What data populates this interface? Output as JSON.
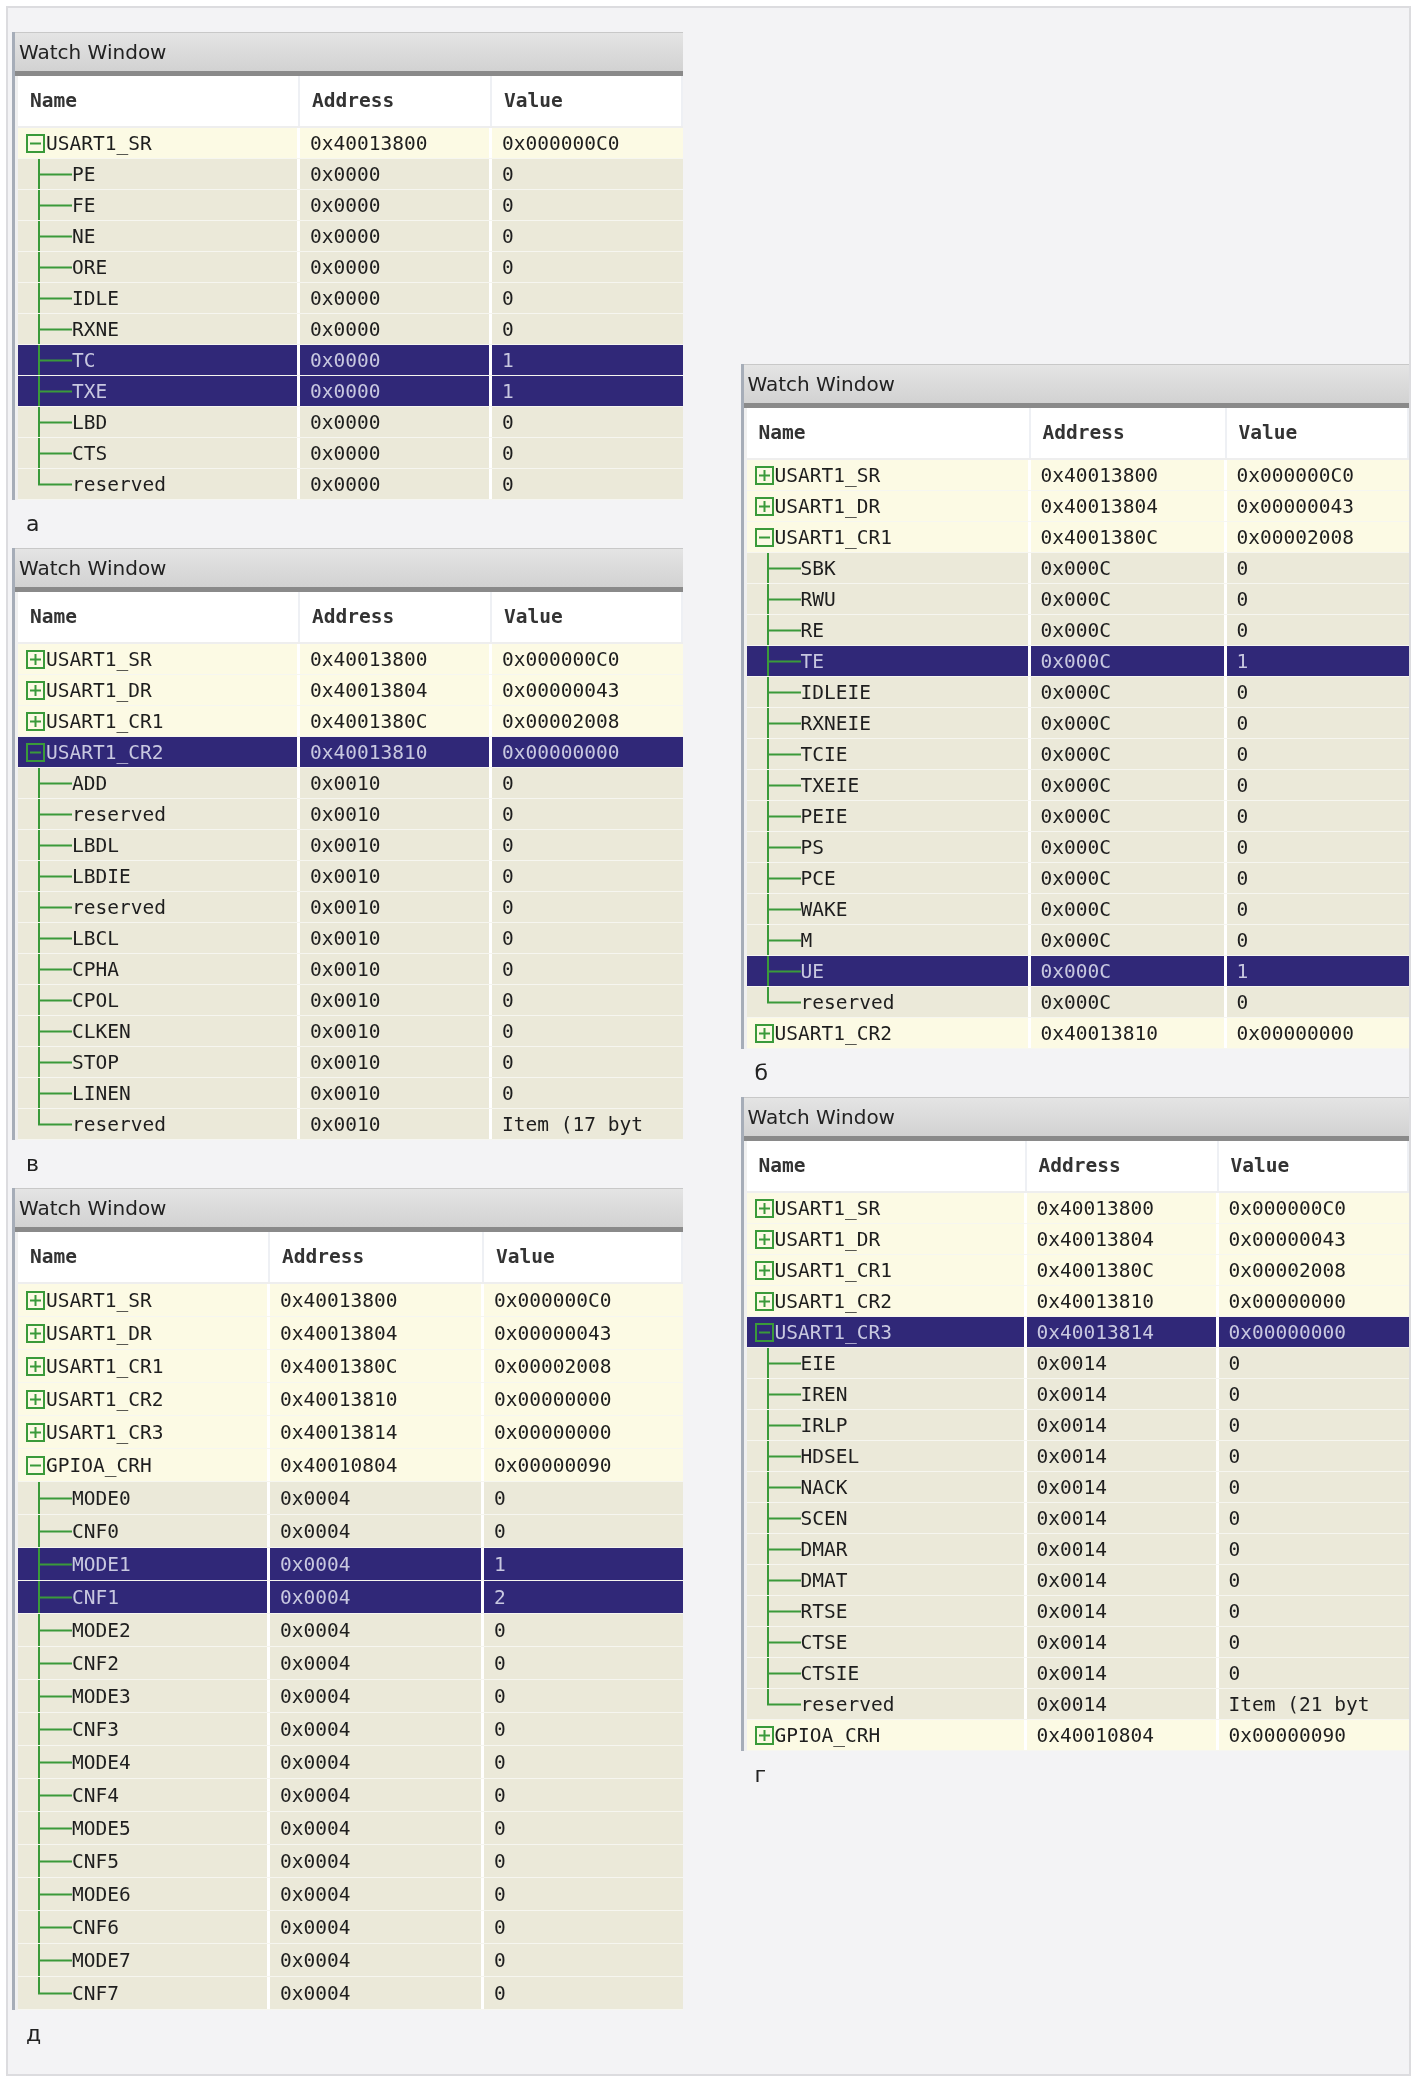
{
  "figure_columns": [
    {
      "panels": [
        {
          "title": "Watch Window",
          "caption": "а",
          "columns": [
            "Name",
            "Address",
            "Value"
          ],
          "rows": [
            {
              "name": "USART1_SR",
              "address": "0x40013800",
              "value": "0x000000C0",
              "expanded": true,
              "selected": false,
              "children": [
                {
                  "name": "PE",
                  "address": "0x0000",
                  "value": "0",
                  "selected": false
                },
                {
                  "name": "FE",
                  "address": "0x0000",
                  "value": "0",
                  "selected": false
                },
                {
                  "name": "NE",
                  "address": "0x0000",
                  "value": "0",
                  "selected": false
                },
                {
                  "name": "ORE",
                  "address": "0x0000",
                  "value": "0",
                  "selected": false
                },
                {
                  "name": "IDLE",
                  "address": "0x0000",
                  "value": "0",
                  "selected": false
                },
                {
                  "name": "RXNE",
                  "address": "0x0000",
                  "value": "0",
                  "selected": false
                },
                {
                  "name": "TC",
                  "address": "0x0000",
                  "value": "1",
                  "selected": true
                },
                {
                  "name": "TXE",
                  "address": "0x0000",
                  "value": "1",
                  "selected": true
                },
                {
                  "name": "LBD",
                  "address": "0x0000",
                  "value": "0",
                  "selected": false
                },
                {
                  "name": "CTS",
                  "address": "0x0000",
                  "value": "0",
                  "selected": false
                },
                {
                  "name": "reserved",
                  "address": "0x0000",
                  "value": "0",
                  "selected": false
                }
              ]
            }
          ]
        },
        {
          "title": "Watch Window",
          "caption": "в",
          "columns": [
            "Name",
            "Address",
            "Value"
          ],
          "rows": [
            {
              "name": "USART1_SR",
              "address": "0x40013800",
              "value": "0x000000C0",
              "expanded": false,
              "selected": false
            },
            {
              "name": "USART1_DR",
              "address": "0x40013804",
              "value": "0x00000043",
              "expanded": false,
              "selected": false
            },
            {
              "name": "USART1_CR1",
              "address": "0x4001380C",
              "value": "0x00002008",
              "expanded": false,
              "selected": false
            },
            {
              "name": "USART1_CR2",
              "address": "0x40013810",
              "value": "0x00000000",
              "expanded": true,
              "selected": true,
              "children": [
                {
                  "name": "ADD",
                  "address": "0x0010",
                  "value": "0",
                  "selected": false
                },
                {
                  "name": "reserved",
                  "address": "0x0010",
                  "value": "0",
                  "selected": false
                },
                {
                  "name": "LBDL",
                  "address": "0x0010",
                  "value": "0",
                  "selected": false
                },
                {
                  "name": "LBDIE",
                  "address": "0x0010",
                  "value": "0",
                  "selected": false
                },
                {
                  "name": "reserved",
                  "address": "0x0010",
                  "value": "0",
                  "selected": false
                },
                {
                  "name": "LBCL",
                  "address": "0x0010",
                  "value": "0",
                  "selected": false
                },
                {
                  "name": "CPHA",
                  "address": "0x0010",
                  "value": "0",
                  "selected": false
                },
                {
                  "name": "CPOL",
                  "address": "0x0010",
                  "value": "0",
                  "selected": false
                },
                {
                  "name": "CLKEN",
                  "address": "0x0010",
                  "value": "0",
                  "selected": false
                },
                {
                  "name": "STOP",
                  "address": "0x0010",
                  "value": "0",
                  "selected": false
                },
                {
                  "name": "LINEN",
                  "address": "0x0010",
                  "value": "0",
                  "selected": false
                },
                {
                  "name": "reserved",
                  "address": "0x0010",
                  "value": "Item (17 byt",
                  "selected": false
                }
              ]
            }
          ]
        },
        {
          "title": "Watch Window",
          "caption": "д",
          "columns": [
            "Name",
            "Address",
            "Value"
          ],
          "rows": [
            {
              "name": "USART1_SR",
              "address": "0x40013800",
              "value": "0x000000C0",
              "expanded": false,
              "selected": false
            },
            {
              "name": "USART1_DR",
              "address": "0x40013804",
              "value": "0x00000043",
              "expanded": false,
              "selected": false
            },
            {
              "name": "USART1_CR1",
              "address": "0x4001380C",
              "value": "0x00002008",
              "expanded": false,
              "selected": false
            },
            {
              "name": "USART1_CR2",
              "address": "0x40013810",
              "value": "0x00000000",
              "expanded": false,
              "selected": false
            },
            {
              "name": "USART1_CR3",
              "address": "0x40013814",
              "value": "0x00000000",
              "expanded": false,
              "selected": false
            },
            {
              "name": "GPIOA_CRH",
              "address": "0x40010804",
              "value": "0x00000090",
              "expanded": true,
              "selected": false,
              "children": [
                {
                  "name": "MODE0",
                  "address": "0x0004",
                  "value": "0",
                  "selected": false
                },
                {
                  "name": "CNF0",
                  "address": "0x0004",
                  "value": "0",
                  "selected": false
                },
                {
                  "name": "MODE1",
                  "address": "0x0004",
                  "value": "1",
                  "selected": true
                },
                {
                  "name": "CNF1",
                  "address": "0x0004",
                  "value": "2",
                  "selected": true
                },
                {
                  "name": "MODE2",
                  "address": "0x0004",
                  "value": "0",
                  "selected": false
                },
                {
                  "name": "CNF2",
                  "address": "0x0004",
                  "value": "0",
                  "selected": false
                },
                {
                  "name": "MODE3",
                  "address": "0x0004",
                  "value": "0",
                  "selected": false
                },
                {
                  "name": "CNF3",
                  "address": "0x0004",
                  "value": "0",
                  "selected": false
                },
                {
                  "name": "MODE4",
                  "address": "0x0004",
                  "value": "0",
                  "selected": false
                },
                {
                  "name": "CNF4",
                  "address": "0x0004",
                  "value": "0",
                  "selected": false
                },
                {
                  "name": "MODE5",
                  "address": "0x0004",
                  "value": "0",
                  "selected": false
                },
                {
                  "name": "CNF5",
                  "address": "0x0004",
                  "value": "0",
                  "selected": false
                },
                {
                  "name": "MODE6",
                  "address": "0x0004",
                  "value": "0",
                  "selected": false
                },
                {
                  "name": "CNF6",
                  "address": "0x0004",
                  "value": "0",
                  "selected": false
                },
                {
                  "name": "MODE7",
                  "address": "0x0004",
                  "value": "0",
                  "selected": false
                },
                {
                  "name": "CNF7",
                  "address": "0x0004",
                  "value": "0",
                  "selected": false
                }
              ]
            }
          ]
        }
      ]
    },
    {
      "panels": [
        {
          "title": "Watch Window",
          "caption": "б",
          "columns": [
            "Name",
            "Address",
            "Value"
          ],
          "rows": [
            {
              "name": "USART1_SR",
              "address": "0x40013800",
              "value": "0x000000C0",
              "expanded": false,
              "selected": false
            },
            {
              "name": "USART1_DR",
              "address": "0x40013804",
              "value": "0x00000043",
              "expanded": false,
              "selected": false
            },
            {
              "name": "USART1_CR1",
              "address": "0x4001380C",
              "value": "0x00002008",
              "expanded": true,
              "selected": false,
              "children": [
                {
                  "name": "SBK",
                  "address": "0x000C",
                  "value": "0",
                  "selected": false
                },
                {
                  "name": "RWU",
                  "address": "0x000C",
                  "value": "0",
                  "selected": false
                },
                {
                  "name": "RE",
                  "address": "0x000C",
                  "value": "0",
                  "selected": false
                },
                {
                  "name": "TE",
                  "address": "0x000C",
                  "value": "1",
                  "selected": true
                },
                {
                  "name": "IDLEIE",
                  "address": "0x000C",
                  "value": "0",
                  "selected": false
                },
                {
                  "name": "RXNEIE",
                  "address": "0x000C",
                  "value": "0",
                  "selected": false
                },
                {
                  "name": "TCIE",
                  "address": "0x000C",
                  "value": "0",
                  "selected": false
                },
                {
                  "name": "TXEIE",
                  "address": "0x000C",
                  "value": "0",
                  "selected": false
                },
                {
                  "name": "PEIE",
                  "address": "0x000C",
                  "value": "0",
                  "selected": false
                },
                {
                  "name": "PS",
                  "address": "0x000C",
                  "value": "0",
                  "selected": false
                },
                {
                  "name": "PCE",
                  "address": "0x000C",
                  "value": "0",
                  "selected": false
                },
                {
                  "name": "WAKE",
                  "address": "0x000C",
                  "value": "0",
                  "selected": false
                },
                {
                  "name": "M",
                  "address": "0x000C",
                  "value": "0",
                  "selected": false
                },
                {
                  "name": "UE",
                  "address": "0x000C",
                  "value": "1",
                  "selected": true
                },
                {
                  "name": "reserved",
                  "address": "0x000C",
                  "value": "0",
                  "selected": false
                }
              ]
            },
            {
              "name": "USART1_CR2",
              "address": "0x40013810",
              "value": "0x00000000",
              "expanded": false,
              "selected": false
            }
          ]
        },
        {
          "title": "Watch Window",
          "caption": "г",
          "columns": [
            "Name",
            "Address",
            "Value"
          ],
          "rows": [
            {
              "name": "USART1_SR",
              "address": "0x40013800",
              "value": "0x000000C0",
              "expanded": false,
              "selected": false
            },
            {
              "name": "USART1_DR",
              "address": "0x40013804",
              "value": "0x00000043",
              "expanded": false,
              "selected": false
            },
            {
              "name": "USART1_CR1",
              "address": "0x4001380C",
              "value": "0x00002008",
              "expanded": false,
              "selected": false
            },
            {
              "name": "USART1_CR2",
              "address": "0x40013810",
              "value": "0x00000000",
              "expanded": false,
              "selected": false
            },
            {
              "name": "USART1_CR3",
              "address": "0x40013814",
              "value": "0x00000000",
              "expanded": true,
              "selected": true,
              "children": [
                {
                  "name": "EIE",
                  "address": "0x0014",
                  "value": "0",
                  "selected": false
                },
                {
                  "name": "IREN",
                  "address": "0x0014",
                  "value": "0",
                  "selected": false
                },
                {
                  "name": "IRLP",
                  "address": "0x0014",
                  "value": "0",
                  "selected": false
                },
                {
                  "name": "HDSEL",
                  "address": "0x0014",
                  "value": "0",
                  "selected": false
                },
                {
                  "name": "NACK",
                  "address": "0x0014",
                  "value": "0",
                  "selected": false
                },
                {
                  "name": "SCEN",
                  "address": "0x0014",
                  "value": "0",
                  "selected": false
                },
                {
                  "name": "DMAR",
                  "address": "0x0014",
                  "value": "0",
                  "selected": false
                },
                {
                  "name": "DMAT",
                  "address": "0x0014",
                  "value": "0",
                  "selected": false
                },
                {
                  "name": "RTSE",
                  "address": "0x0014",
                  "value": "0",
                  "selected": false
                },
                {
                  "name": "CTSE",
                  "address": "0x0014",
                  "value": "0",
                  "selected": false
                },
                {
                  "name": "CTSIE",
                  "address": "0x0014",
                  "value": "0",
                  "selected": false
                },
                {
                  "name": "reserved",
                  "address": "0x0014",
                  "value": "Item (21 byt",
                  "selected": false
                }
              ]
            },
            {
              "name": "GPIOA_CRH",
              "address": "0x40010804",
              "value": "0x00000090",
              "expanded": false,
              "selected": false
            }
          ]
        }
      ]
    }
  ]
}
